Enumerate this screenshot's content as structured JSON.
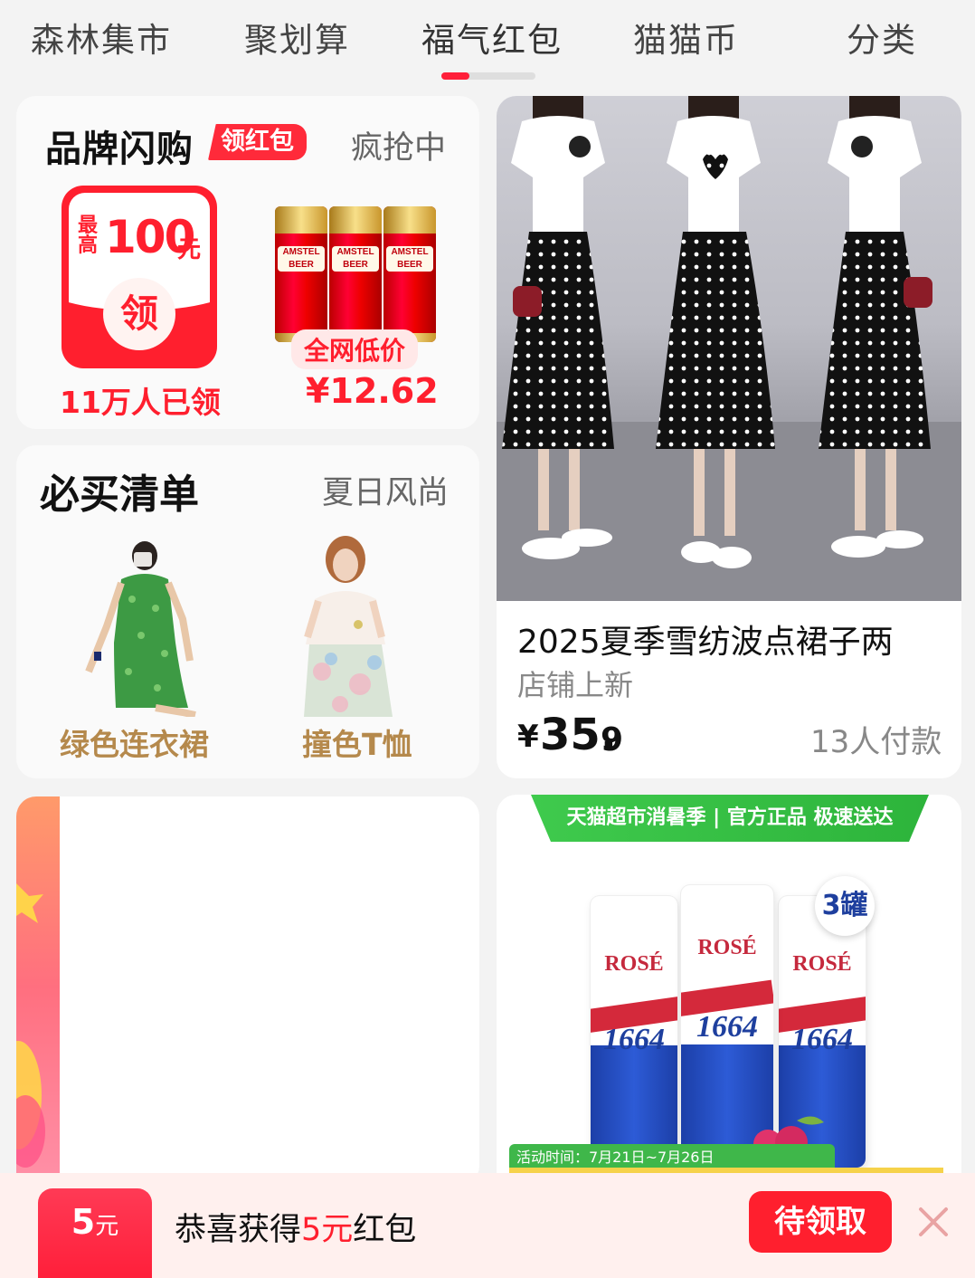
{
  "tabs": [
    {
      "label": "森林集市"
    },
    {
      "label": "聚划算"
    },
    {
      "label": "福气红包"
    },
    {
      "label": "猫猫币"
    },
    {
      "label": "分类"
    }
  ],
  "active_tab": 2,
  "brand_flash": {
    "title": "品牌闪购",
    "badge": "领红包",
    "status": "疯抢中",
    "coupon": {
      "small_label": "最高",
      "amount": "100",
      "unit": "元",
      "button": "领",
      "caption": "11万人已领"
    },
    "product": {
      "brand": "AMSTEL",
      "sub": "BEER",
      "tag": "全网低价",
      "price": "¥12.62"
    }
  },
  "must_buy": {
    "title": "必买清单",
    "subtitle": "夏日风尚",
    "items": [
      {
        "label": "绿色连衣裙"
      },
      {
        "label": "撞色T恤"
      }
    ]
  },
  "featured": {
    "title": "2025夏季雪纺波点裙子两",
    "tag": "店铺上新",
    "price_symbol": "¥",
    "price_int": "35.",
    "price_dec": "9",
    "sold": "13人付款"
  },
  "promo_card": {
    "banner": "天猫超市消暑季 | 官方正品 极速送达",
    "can_text": "ROSÉ",
    "can_number": "1664",
    "badge": "3罐",
    "date": "活动时间：7月21日~7月26日"
  },
  "notification": {
    "badge_amount": "5",
    "badge_unit": "元",
    "text_prefix": "恭喜获得",
    "text_highlight": "5元",
    "text_suffix": "红包",
    "button": "待领取"
  },
  "colors": {
    "accent": "#ff1f2e",
    "gold": "#b5894c",
    "background": "#f3f3f3"
  }
}
